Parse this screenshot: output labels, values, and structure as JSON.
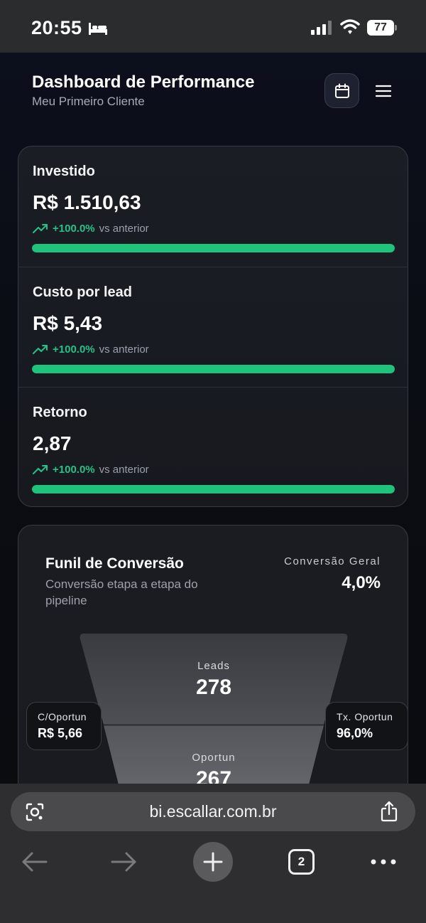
{
  "status": {
    "time": "20:55",
    "battery": "77",
    "icons": [
      "bed-icon",
      "signal-icon",
      "wifi-icon",
      "battery-icon"
    ]
  },
  "header": {
    "title": "Dashboard de Performance",
    "subtitle": "Meu Primeiro Cliente",
    "calendar_icon": "calendar-icon",
    "menu_icon": "menu-icon"
  },
  "metrics": [
    {
      "label": "Investido",
      "value": "R$ 1.510,63",
      "trend": "+100.0%",
      "trend_suffix": "vs anterior",
      "progress": 1.0
    },
    {
      "label": "Custo por lead",
      "value": "R$ 5,43",
      "trend": "+100.0%",
      "trend_suffix": "vs anterior",
      "progress": 1.0
    },
    {
      "label": "Retorno",
      "value": "2,87",
      "trend": "+100.0%",
      "trend_suffix": "vs anterior",
      "progress": 1.0
    }
  ],
  "funnel": {
    "title": "Funil de Conversão",
    "subtitle": "Conversão etapa a etapa do pipeline",
    "overall_label": "Conversão Geral",
    "overall_value": "4,0%",
    "stages": [
      {
        "label": "Leads",
        "value": "278"
      },
      {
        "label": "Oportun",
        "value": "267"
      }
    ],
    "cost_box": {
      "label": "C/Oportun",
      "value": "R$ 5,66"
    },
    "rate_box": {
      "label": "Tx. Oportun",
      "value": "96,0%"
    }
  },
  "colors": {
    "accent_green": "#1fc47c",
    "trend_green": "#27c187"
  },
  "browser": {
    "url": "bi.escallar.com.br",
    "tab_count": "2",
    "icons": [
      "lens-icon",
      "share-icon",
      "back-arrow-icon",
      "forward-arrow-icon",
      "plus-icon",
      "more-icon"
    ]
  }
}
